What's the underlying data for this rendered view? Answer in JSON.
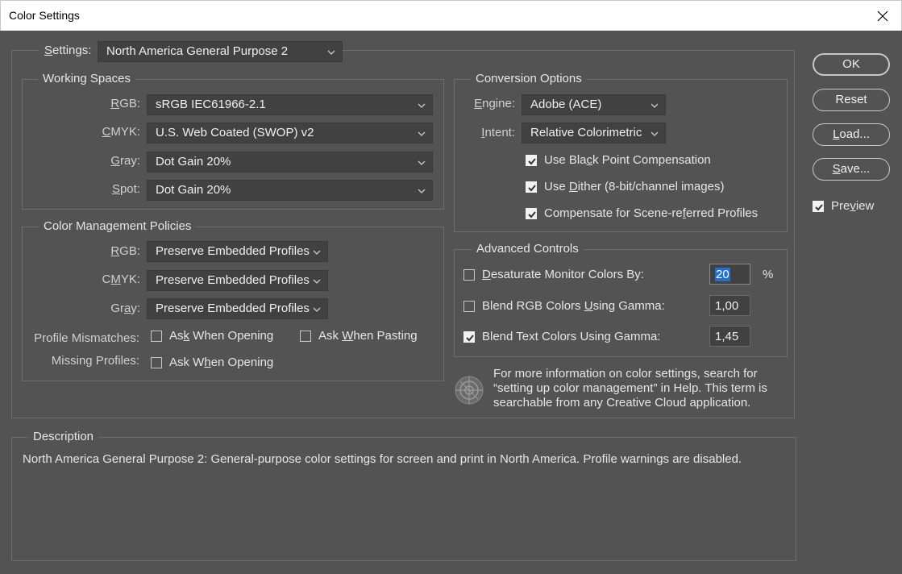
{
  "window": {
    "title": "Color Settings"
  },
  "settings": {
    "label": "Settings:",
    "value": "North America General Purpose 2"
  },
  "working_spaces": {
    "title": "Working Spaces",
    "rgb_label": "RGB:",
    "rgb_value": "sRGB IEC61966-2.1",
    "cmyk_label": "CMYK:",
    "cmyk_value": "U.S. Web Coated (SWOP) v2",
    "gray_label": "Gray:",
    "gray_value": "Dot Gain 20%",
    "spot_label": "Spot:",
    "spot_value": "Dot Gain 20%"
  },
  "policies": {
    "title": "Color Management Policies",
    "rgb_label": "RGB:",
    "rgb_value": "Preserve Embedded Profiles",
    "cmyk_label": "CMYK:",
    "cmyk_value": "Preserve Embedded Profiles",
    "gray_label": "Gray:",
    "gray_value": "Preserve Embedded Profiles",
    "mismatch_label": "Profile Mismatches:",
    "ask_opening_label": "Ask When Opening",
    "ask_opening_checked": false,
    "ask_pasting_label": "Ask When Pasting",
    "ask_pasting_checked": false,
    "missing_label": "Missing Profiles:",
    "missing_ask_opening_label": "Ask When Opening",
    "missing_ask_opening_checked": false
  },
  "conversion": {
    "title": "Conversion Options",
    "engine_label": "Engine:",
    "engine_value": "Adobe (ACE)",
    "intent_label": "Intent:",
    "intent_value": "Relative Colorimetric",
    "bpc_label": "Use Black Point Compensation",
    "bpc_checked": true,
    "dither_label": "Use Dither (8-bit/channel images)",
    "dither_checked": true,
    "scene_label": "Compensate for Scene-referred Profiles",
    "scene_checked": true
  },
  "advanced": {
    "title": "Advanced Controls",
    "desaturate_label": "Desaturate Monitor Colors By:",
    "desaturate_checked": false,
    "desaturate_value": "20",
    "desaturate_unit": "%",
    "blend_rgb_label": "Blend RGB Colors Using Gamma:",
    "blend_rgb_checked": false,
    "blend_rgb_value": "1,00",
    "blend_text_label": "Blend Text Colors Using Gamma:",
    "blend_text_checked": true,
    "blend_text_value": "1,45"
  },
  "info": {
    "icon": "color-settings-info-icon",
    "line1": "For more information on color settings, search for",
    "line2": "“setting up color management” in Help. This term is",
    "line3": "searchable from any Creative Cloud application."
  },
  "description": {
    "title": "Description",
    "text": "North America General Purpose 2:  General-purpose color settings for screen and print in North America. Profile warnings are disabled."
  },
  "buttons": {
    "ok": "OK",
    "reset": "Reset",
    "load": "Load...",
    "save": "Save..."
  },
  "preview": {
    "label": "Preview",
    "checked": true
  },
  "colors": {
    "dialog_bg": "#535353",
    "field_bg": "#414141",
    "selection": "#1f6fd4"
  }
}
